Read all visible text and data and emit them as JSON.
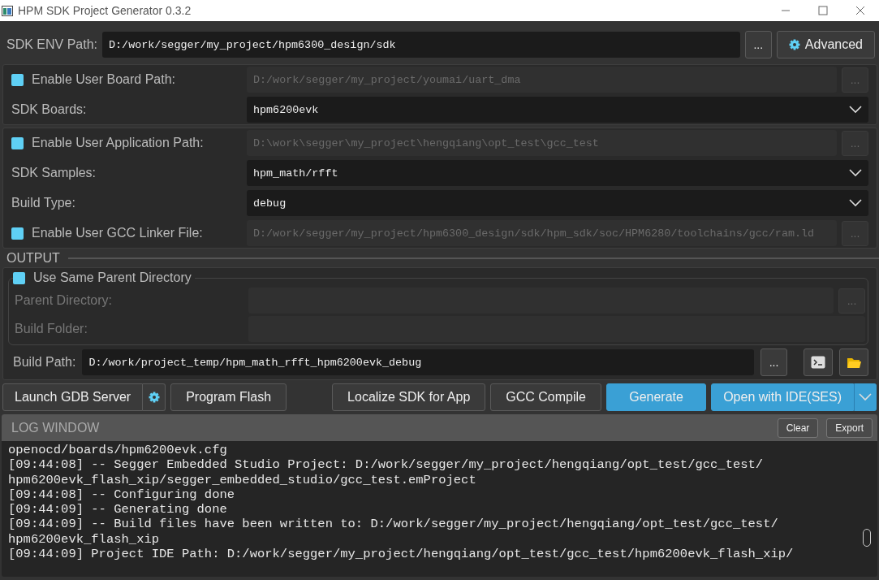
{
  "window": {
    "title": "HPM SDK Project Generator 0.3.2"
  },
  "sdk_env": {
    "label": "SDK ENV Path:",
    "value": "D:/work/segger/my_project/hpm6300_design/sdk",
    "browse": "...",
    "advanced": "Advanced"
  },
  "panels": [
    [
      {
        "kind": "checkpath",
        "label": "Enable User Board Path:",
        "checked": false,
        "value": "D:/work/segger/my_project/youmai/uart_dma",
        "browse": "..."
      },
      {
        "kind": "dropdown",
        "label": "SDK Boards:",
        "value": "hpm6200evk"
      }
    ],
    [
      {
        "kind": "checkpath",
        "label": "Enable User Application Path:",
        "checked": false,
        "value": "D:\\work\\segger\\my_project\\hengqiang\\opt_test\\gcc_test",
        "browse": "..."
      },
      {
        "kind": "dropdown",
        "label": "SDK Samples:",
        "value": "hpm_math/rfft"
      },
      {
        "kind": "dropdown",
        "label": "Build Type:",
        "value": "debug"
      },
      {
        "kind": "checkpath",
        "label": "Enable User GCC Linker File:",
        "checked": false,
        "value": "D:/work/segger/my_project/hpm6300_design/sdk/hpm_sdk/soc/HPM6280/toolchains/gcc/ram.ld",
        "browse": "..."
      }
    ]
  ],
  "output": {
    "title": "OUTPUT",
    "same_parent": {
      "label": "Use Same Parent Directory",
      "checked": false
    },
    "parent_directory": {
      "label": "Parent Directory:",
      "browse": "..."
    },
    "build_folder": {
      "label": "Build Folder:"
    },
    "build_path": {
      "label": "Build Path:",
      "value": "D:/work/project_temp/hpm_math_rfft_hpm6200evk_debug",
      "browse": "..."
    }
  },
  "buttons": [
    {
      "label": "Launch GDB Server",
      "kind": "gdb"
    },
    {
      "label": "Program Flash",
      "kind": "plain"
    },
    {
      "label": "Localize SDK for App",
      "kind": "plain"
    },
    {
      "label": "GCC Compile",
      "kind": "plain"
    },
    {
      "label": "Generate",
      "kind": "primary"
    },
    {
      "label": "Open with IDE(SES)",
      "kind": "split"
    }
  ],
  "log": {
    "title": "LOG WINDOW",
    "clear": "Clear",
    "export": "Export",
    "lines": [
      "openocd/boards/hpm6200evk.cfg",
      "[09:44:08] -- Segger Embedded Studio Project: D:/work/segger/my_project/hengqiang/opt_test/gcc_test/",
      "hpm6200evk_flash_xip/segger_embedded_studio/gcc_test.emProject",
      "[09:44:08] -- Configuring done",
      "[09:44:09] -- Generating done",
      "[09:44:09] -- Build files have been written to: D:/work/segger/my_project/hengqiang/opt_test/gcc_test/",
      "hpm6200evk_flash_xip",
      "[09:44:09] Project IDE Path: D:/work/segger/my_project/hengqiang/opt_test/gcc_test/hpm6200evk_flash_xip/"
    ]
  }
}
